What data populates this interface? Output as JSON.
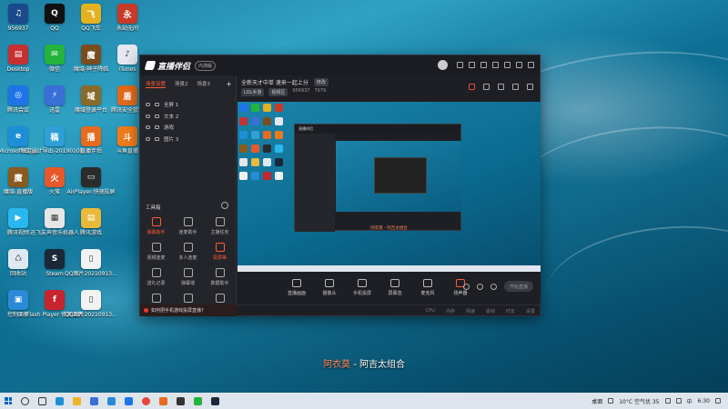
{
  "desktop": {
    "icons": [
      {
        "id": "c1r1",
        "label": "",
        "sub": "956937",
        "color": "#1b4a8c",
        "glyph": "♫"
      },
      {
        "id": "c2r1",
        "label": "QQ",
        "color": "#111",
        "glyph": "Q"
      },
      {
        "id": "c3r1",
        "label": "QQ飞车",
        "color": "#e3b21f",
        "glyph": "飞"
      },
      {
        "id": "c4r1",
        "label": "永劫无间",
        "color": "#c83a28",
        "glyph": "永"
      },
      {
        "id": "c1r2",
        "label": "Desktop",
        "color": "#c53030",
        "glyph": "▤"
      },
      {
        "id": "c2r2",
        "label": "微信",
        "color": "#24b33c",
        "glyph": "✉"
      },
      {
        "id": "c3r2",
        "label": "魔域-神子降临",
        "color": "#7a4d1f",
        "glyph": "魔"
      },
      {
        "id": "c4r2",
        "label": "iTunes",
        "color": "#e7e7f1",
        "glyph": "♪"
      },
      {
        "id": "c1r3",
        "label": "腾讯会议",
        "color": "#1f73e8",
        "glyph": "◎"
      },
      {
        "id": "c2r3",
        "label": "迅雷",
        "color": "#3a6fd8",
        "glyph": "⚡"
      },
      {
        "id": "c3r3",
        "label": "魔域登录平台",
        "color": "#8a6a2a",
        "glyph": "域"
      },
      {
        "id": "c4r3",
        "label": "腾讯安全管家",
        "color": "#e06a1c",
        "glyph": "盾"
      },
      {
        "id": "c1r4",
        "label": "Microsoft Edge",
        "color": "#1c8fd6",
        "glyph": "e"
      },
      {
        "id": "c2r4",
        "label": "稿定设计导出-20190108...",
        "color": "#2f9fd8",
        "glyph": "稿"
      },
      {
        "id": "c3r4",
        "label": "直播伴侣",
        "color": "#e76b1e",
        "glyph": "播"
      },
      {
        "id": "c4r4",
        "label": "斗鱼直播",
        "color": "#f07b1a",
        "glyph": "斗"
      },
      {
        "id": "c1r5",
        "label": "魔域-直播版",
        "color": "#8a5a1f",
        "glyph": "魔"
      },
      {
        "id": "c2r5",
        "label": "火萤",
        "color": "#e8582a",
        "glyph": "火"
      },
      {
        "id": "c3r5",
        "label": "AirPlayer-快速投屏",
        "color": "#2b2b2b",
        "glyph": "▭"
      },
      {
        "id": "c1r6",
        "label": "腾讯视频",
        "color": "#29b7ef",
        "glyph": "▶"
      },
      {
        "id": "c2r6",
        "label": "迅飞友声音乐机器人",
        "color": "#e6e6e6",
        "glyph": "▦"
      },
      {
        "id": "c3r6",
        "label": "腾讯游戏",
        "color": "#e9b93a",
        "glyph": "▤"
      },
      {
        "id": "c1r7",
        "label": "回收站",
        "color": "#dfe9f2",
        "glyph": "♺"
      },
      {
        "id": "c2r7",
        "label": "Steam",
        "color": "#1b2838",
        "glyph": "S"
      },
      {
        "id": "c3r7",
        "label": "QQ图片20210913...",
        "color": "#f2f2f2",
        "glyph": "▯"
      },
      {
        "id": "c1r8",
        "label": "控制面板",
        "color": "#2b8ad8",
        "glyph": "▣"
      },
      {
        "id": "c2r8",
        "label": "Flash Player 修复工具",
        "color": "#c8242e",
        "glyph": "f"
      },
      {
        "id": "c3r8",
        "label": "QQ图片20210913...",
        "color": "#f2f2f2",
        "glyph": "▯"
      }
    ]
  },
  "app": {
    "name": "直播伴侣",
    "badge": "内测版",
    "scene_tabs": [
      "场景设置",
      "场景2",
      "场景3"
    ],
    "sources": [
      "全屏 1",
      "文本 2",
      "游戏",
      "图片 3"
    ],
    "tools_title": "工具箱",
    "tools": [
      "弹幕助手",
      "连麦助手",
      "主播任务",
      "视频连麦",
      "多人连麦",
      "投屏等",
      "送礼记录",
      "弹幕墙",
      "数据助手",
      "弹幕",
      "主播",
      "小工具"
    ],
    "notice": "如何把手机游戏投屏直播?",
    "stream_title": "全新天才中单 速来一起上分",
    "stream_tag": "修改",
    "meta": [
      "LOL手游",
      "视频区",
      "956937",
      "7979"
    ],
    "preview_caption": "阿衣莫 - 阿吉太组合",
    "bottom_buttons": [
      "直播画面",
      "摄像头",
      "手机投屏",
      "屏幕选",
      "麦克风",
      "扬声器"
    ],
    "start_live": "开始直播",
    "status": [
      "CPU",
      "内存",
      "网速",
      "丢帧",
      "时长",
      "设置"
    ]
  },
  "lyric": {
    "artist": "阿衣莫",
    "sep": " - ",
    "song": "阿吉太组合"
  },
  "taskbar": {
    "input_label": "桌面",
    "weather": "10°C 空气优 35",
    "lang": "中",
    "time": "6:30"
  }
}
